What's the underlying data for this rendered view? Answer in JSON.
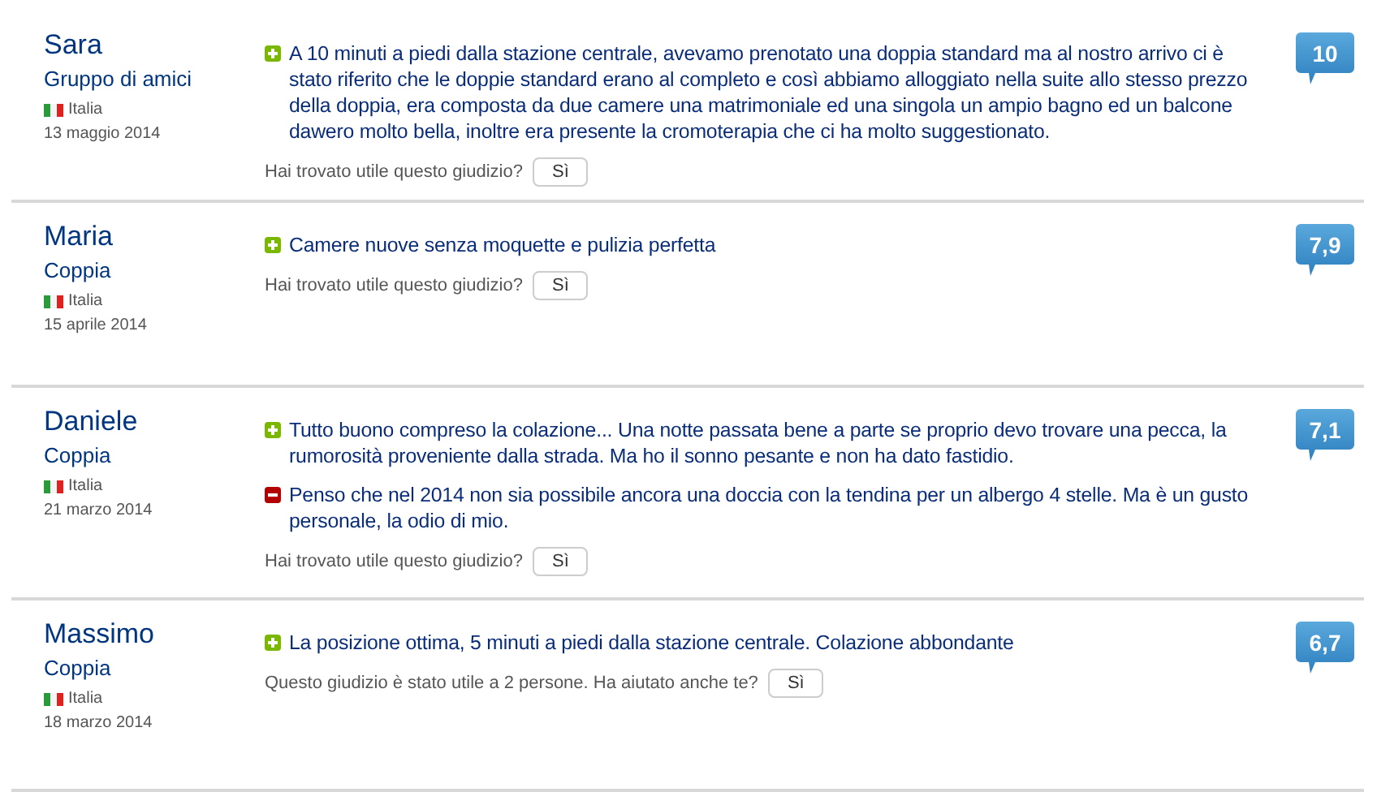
{
  "reviews": [
    {
      "name": "Sara",
      "group": "Gruppo di amici",
      "country": "Italia",
      "date": "13 maggio 2014",
      "score": "10",
      "comments": [
        {
          "kind": "pro",
          "text": "A 10 minuti a piedi dalla stazione centrale, avevamo prenotato una doppia standard ma al nostro arrivo ci è stato riferito che le doppie standard erano al completo e così abbiamo alloggiato nella suite allo stesso prezzo della doppia, era composta da due camere una matrimoniale ed una singola un ampio bagno ed un balcone dawero molto bella, inoltre era presente la cromoterapia che ci ha molto suggestionato."
        }
      ],
      "helpful_prompt": "Hai trovato utile questo giudizio?",
      "helpful_button": "Sì"
    },
    {
      "name": "Maria",
      "group": "Coppia",
      "country": "Italia",
      "date": "15 aprile 2014",
      "score": "7,9",
      "comments": [
        {
          "kind": "pro",
          "text": "Camere nuove senza moquette e pulizia perfetta"
        }
      ],
      "helpful_prompt": "Hai trovato utile questo giudizio?",
      "helpful_button": "Sì"
    },
    {
      "name": "Daniele",
      "group": "Coppia",
      "country": "Italia",
      "date": "21 marzo 2014",
      "score": "7,1",
      "comments": [
        {
          "kind": "pro",
          "text": "Tutto buono compreso la colazione... Una notte passata bene a parte se proprio devo trovare una pecca, la rumorosità proveniente dalla strada. Ma ho il sonno pesante e non ha dato fastidio."
        },
        {
          "kind": "con",
          "text": "Penso che nel 2014 non sia possibile ancora una doccia con la tendina per un albergo 4 stelle. Ma è un gusto personale, la odio di mio."
        }
      ],
      "helpful_prompt": "Hai trovato utile questo giudizio?",
      "helpful_button": "Sì"
    },
    {
      "name": "Massimo",
      "group": "Coppia",
      "country": "Italia",
      "date": "18 marzo 2014",
      "score": "6,7",
      "comments": [
        {
          "kind": "pro",
          "text": "La posizione ottima, 5 minuti a piedi dalla stazione centrale. Colazione abbondante"
        }
      ],
      "helpful_prompt": "Questo giudizio è stato utile a 2 persone. Ha aiutato anche te?",
      "helpful_button": "Sì"
    }
  ]
}
